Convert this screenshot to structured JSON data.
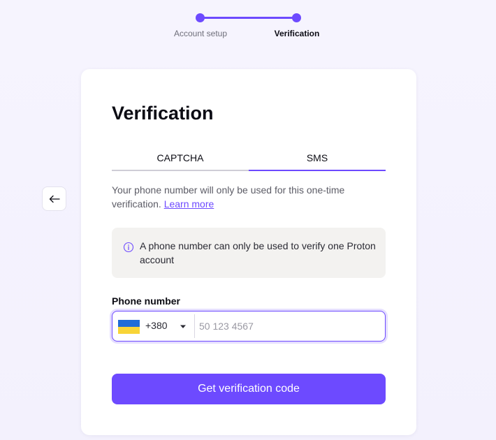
{
  "stepper": {
    "steps": [
      {
        "label": "Account setup",
        "state": "completed"
      },
      {
        "label": "Verification",
        "state": "active"
      }
    ]
  },
  "back_button": {
    "icon": "arrow-left-icon"
  },
  "card": {
    "title": "Verification",
    "tabs": [
      {
        "label": "CAPTCHA",
        "selected": false
      },
      {
        "label": "SMS",
        "selected": true
      }
    ],
    "description": "Your phone number will only be used for this one-time verification.",
    "learn_more": "Learn more",
    "info": {
      "icon": "info-icon",
      "text": "A phone number can only be used to verify one Proton account"
    },
    "phone": {
      "label": "Phone number",
      "country_flag": "ukraine-flag-icon",
      "dial_code": "+380",
      "value": "",
      "placeholder": "50 123 4567"
    },
    "submit_label": "Get verification code"
  },
  "colors": {
    "accent": "#6d4aff",
    "background": "#f5f3fe",
    "card": "#ffffff",
    "info_bg": "#f3f2f0"
  }
}
